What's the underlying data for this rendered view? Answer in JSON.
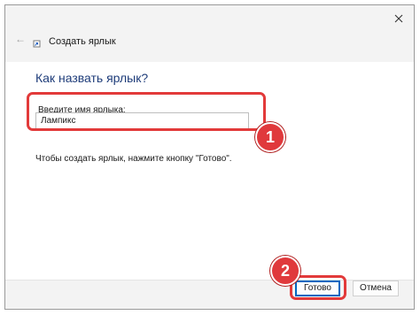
{
  "window": {
    "back_icon": "←",
    "title": "Создать ярлык",
    "close_icon": "close-icon"
  },
  "main": {
    "heading": "Как назвать ярлык?",
    "name_label": "Введите имя ярлыка:",
    "name_value": "Лампикс",
    "hint": "Чтобы создать ярлык, нажмите кнопку \"Готово\"."
  },
  "footer": {
    "finish_label": "Готово",
    "cancel_label": "Отмена"
  },
  "annotations": {
    "step1": "1",
    "step2": "2",
    "color": "#e23a3a"
  },
  "colors": {
    "accent": "#0067c0",
    "heading": "#1f3d7a",
    "titlebar_bg": "#f3f3f3"
  }
}
